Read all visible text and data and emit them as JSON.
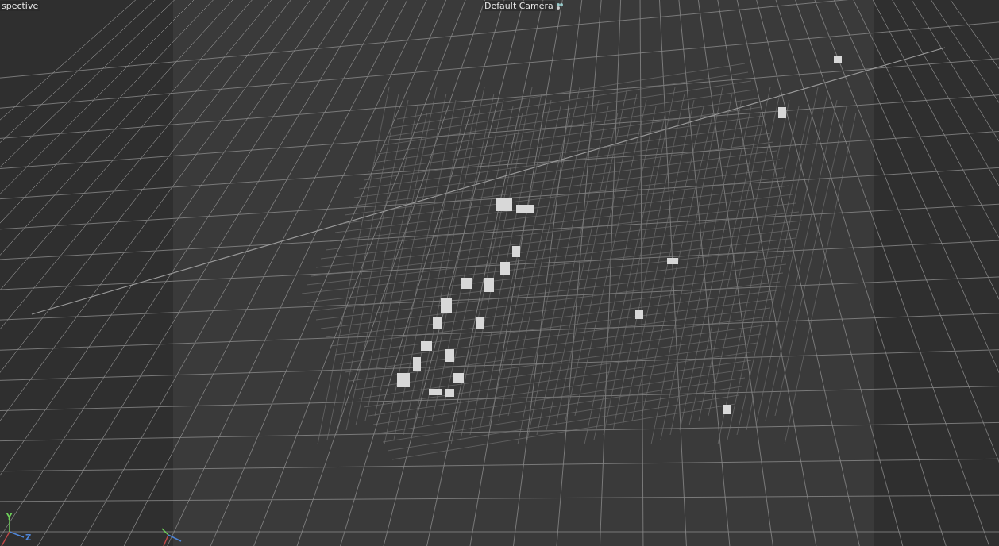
{
  "viewport": {
    "view_label": "spective",
    "camera_label": "Default Camera",
    "axis_labels": [
      "Y",
      "Z"
    ]
  }
}
